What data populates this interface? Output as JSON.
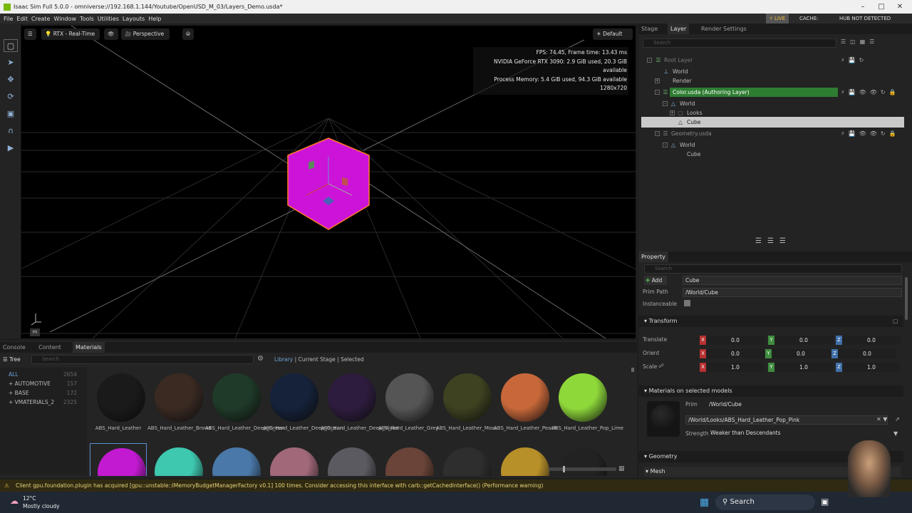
{
  "window": {
    "title": "Isaac Sim Full 5.0.0 - omniverse://192.168.1.144/Youtube/OpenUSD_M_03/Layers_Demo.usda*"
  },
  "menubar": {
    "items": [
      "File",
      "Edit",
      "Create",
      "Window",
      "Tools",
      "Utilities",
      "Layouts",
      "Help"
    ],
    "live_label": "LIVE",
    "cache_label": "CACHE:",
    "hub_status": "HUB NOT DETECTED"
  },
  "viewport": {
    "renderer": "RTX - Real-Time",
    "camera": "Perspective",
    "lighting": "Default",
    "stats": {
      "fps": "FPS: 74.45, Frame time: 13.43 ms",
      "gpu": "NVIDIA GeForce RTX 3090: 2.9 GiB used, 20.3 GiB available",
      "memory": "Process Memory: 5.4 GiB used, 94.3 GiB available",
      "resolution": "1280x720"
    },
    "units_label": "m",
    "cube_color": "#cc14d9"
  },
  "right_panel": {
    "tabs": [
      "Stage",
      "Layer",
      "Render Settings"
    ],
    "search_placeholder": "Search",
    "layer_tree": [
      {
        "label": "Root Layer"
      },
      {
        "label": "World"
      },
      {
        "label": "Render"
      },
      {
        "label": "Color.usda (Authoring Layer)"
      },
      {
        "label": "World"
      },
      {
        "label": "Looks"
      },
      {
        "label": "Cube"
      },
      {
        "label": "Geometry.usda"
      },
      {
        "label": "World"
      },
      {
        "label": "Cube"
      }
    ],
    "authoring_color": "#2e7d32"
  },
  "property": {
    "title": "Property",
    "search_placeholder": "Search",
    "add_label": "Add",
    "name_value": "Cube",
    "prim_path_label": "Prim Path",
    "prim_path_value": "/World/Cube",
    "instanceable_label": "Instanceable",
    "transform_title": "Transform",
    "rows": [
      {
        "label": "Translate",
        "x": "0.0",
        "y": "0.0",
        "z": "0.0"
      },
      {
        "label": "Orient",
        "x": "0.0",
        "y": "0.0",
        "z": "0.0"
      },
      {
        "label": "Scale",
        "x": "1.0",
        "y": "1.0",
        "z": "1.0"
      }
    ],
    "axis_labels": {
      "x": "X",
      "y": "Y",
      "z": "Z"
    },
    "materials_title": "Materials on selected models",
    "prim_label": "Prim",
    "prim_value": "/World/Cube",
    "material_path": "/World/Looks/ABS_Hard_Leather_Pop_Pink",
    "strength_label": "Strength",
    "strength_value": "Weaker than Descendants",
    "geometry_title": "Geometry",
    "mesh_title": "Mesh"
  },
  "bottom_panel": {
    "tabs": [
      "Console",
      "Content",
      "Materials"
    ],
    "tree_label": "Tree",
    "search_placeholder": "Search",
    "filters": [
      "Library",
      "Current Stage",
      "Selected"
    ],
    "categories": [
      {
        "name": "ALL",
        "count": "2654"
      },
      {
        "name": "+ AUTOMOTIVE",
        "count": "157"
      },
      {
        "name": "+ BASE",
        "count": "172"
      },
      {
        "name": "+ VMATERIALS_2",
        "count": "2325"
      }
    ],
    "materials_row1": [
      {
        "name": "ABS_Hard_Leather",
        "color": "#1a1a1a"
      },
      {
        "name": "ABS_Hard_Leather_Brown",
        "color": "#3a2a22"
      },
      {
        "name": "ABS_Hard_Leather_Deep_Green",
        "color": "#1f3a28"
      },
      {
        "name": "ABS_Hard_Leather_Deep_Ocean",
        "color": "#15223a"
      },
      {
        "name": "ABS_Hard_Leather_Deep_Violet",
        "color": "#2e1c3e"
      },
      {
        "name": "ABS_Hard_Leather_Grey",
        "color": "#555555"
      },
      {
        "name": "ABS_Hard_Leather_Moss",
        "color": "#3e4220"
      },
      {
        "name": "ABS_Hard_Leather_Peach",
        "color": "#c8683a"
      },
      {
        "name": "ABS_Hard_Leather_Pop_Lime",
        "color": "#8ed83a"
      }
    ],
    "materials_row2_colors": [
      "#c21ad0",
      "#3ec8b0",
      "#4a78a8",
      "#a06878",
      "#5a5a60",
      "#6a4438",
      "#2e2e2e",
      "#b8902a",
      "#222222"
    ]
  },
  "status": {
    "message": "Client gpu.foundation.plugin has acquired [gpu::unstable::IMemoryBudgetManagerFactory v0.1] 100 times. Consider accessing this interface with carb::getCachedInterface() (Performance warning)"
  },
  "taskbar": {
    "temperature": "12°C",
    "weather": "Mostly cloudy",
    "search_label": "Search"
  }
}
